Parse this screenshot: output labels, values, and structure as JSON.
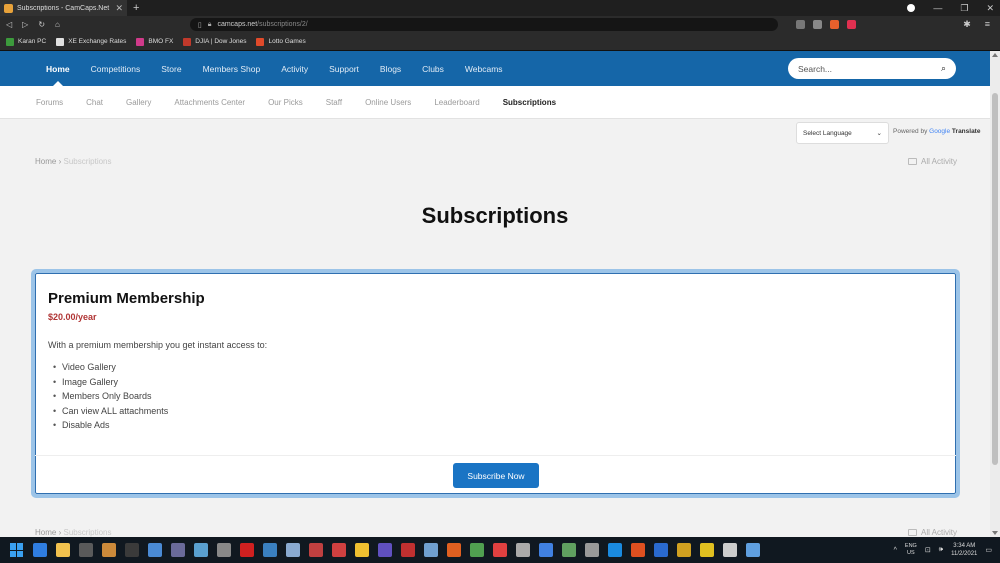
{
  "browser": {
    "tab_title": "Subscriptions - CamCaps.Net",
    "url_host": "camcaps.net",
    "url_path": "/subscriptions/2/",
    "bookmarks": [
      {
        "label": "Karan PC",
        "color": "#3c9a3c"
      },
      {
        "label": "XE Exchange Rates",
        "color": "#e0e0e0"
      },
      {
        "label": "BMO FX",
        "color": "#d03a8a"
      },
      {
        "label": "DJIA | Dow Jones",
        "color": "#c0392b"
      },
      {
        "label": "Lotto Games",
        "color": "#e04a2a"
      }
    ]
  },
  "nav": {
    "items": [
      "Home",
      "Competitions",
      "Store",
      "Members Shop",
      "Activity",
      "Support",
      "Blogs",
      "Clubs",
      "Webcams"
    ],
    "active": "Home",
    "search_placeholder": "Search..."
  },
  "subnav": {
    "items": [
      "Forums",
      "Chat",
      "Gallery",
      "Attachments Center",
      "Our Picks",
      "Staff",
      "Online Users",
      "Leaderboard",
      "Subscriptions"
    ],
    "active": "Subscriptions"
  },
  "translate": {
    "select_label": "Select Language",
    "powered_by": "Powered by",
    "google": "Google",
    "translate": "Translate"
  },
  "breadcrumb": {
    "home": "Home",
    "sep": "›",
    "current": "Subscriptions"
  },
  "all_activity": "All Activity",
  "page_title": "Subscriptions",
  "plan": {
    "title": "Premium Membership",
    "price": "$20.00/year",
    "description": "With a premium membership you get instant access to:",
    "features": [
      "Video Gallery",
      "Image Gallery",
      "Members Only Boards",
      "Can view ALL attachments",
      "Disable Ads"
    ],
    "button": "Subscribe Now"
  },
  "taskbar": {
    "lang_line1": "ENG",
    "lang_line2": "US",
    "time": "3:34 AM",
    "date": "11/2/2021",
    "icon_colors": [
      "#2f7de1",
      "#f2c14e",
      "#5a5a5a",
      "#cc8a3a",
      "#3a3a3a",
      "#4a8ad4",
      "#6a6a9a",
      "#5aa0d0",
      "#888",
      "#d02020",
      "#3a80c0",
      "#8aaad0",
      "#c04040",
      "#d04040",
      "#f0c030",
      "#6050c0",
      "#c03030",
      "#70a0d0",
      "#e06020",
      "#50a050",
      "#e04040",
      "#aaa",
      "#4080e0",
      "#60a060",
      "#999",
      "#1a8ae0",
      "#e05020",
      "#2a6ad0",
      "#d0a020",
      "#e0c020",
      "#ccc",
      "#60a0e0"
    ]
  },
  "colors": {
    "nav_bg": "#1566a8",
    "price": "#b03434",
    "button": "#1a74c4",
    "card_border": "#9cc4e8"
  }
}
